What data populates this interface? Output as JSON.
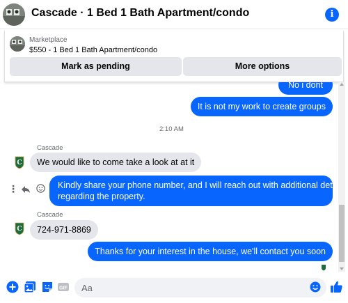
{
  "header": {
    "title": "Cascade · 1 Bed 1 Bath Apartment/condo"
  },
  "marketplace": {
    "source": "Marketplace",
    "listing": "$550 - 1 Bed 1 Bath Apartment/condo",
    "mark_pending_label": "Mark as pending",
    "more_options_label": "More options"
  },
  "messages": {
    "out_partial": "No i dont",
    "out_1": "It is not my work to create groups",
    "timestamp": "2:10 AM",
    "sender_1": "Cascade",
    "in_1": "We would like to come take a look at at it",
    "out_2_line1": "Kindly share your phone number, and I will reach out with additional details",
    "out_2_line2": "regarding the property.",
    "sender_2": "Cascade",
    "in_2": "724-971-8869",
    "out_3": "Thanks for your interest in the house, we'll contact you soon"
  },
  "composer": {
    "placeholder": "Aa"
  },
  "colors": {
    "accent": "#0866ff",
    "incoming_bubble": "#e4e6eb",
    "brand_green": "#1e6b3c"
  },
  "icons": {
    "info": "info-icon",
    "more_actions": "more-vertical-icon",
    "reply": "reply-icon",
    "react": "smiley-icon",
    "add": "plus-circle-icon",
    "photo": "photo-icon",
    "sticker": "sticker-icon",
    "gif": "gif-icon",
    "emoji": "emoji-icon",
    "like": "thumbs-up-icon"
  }
}
